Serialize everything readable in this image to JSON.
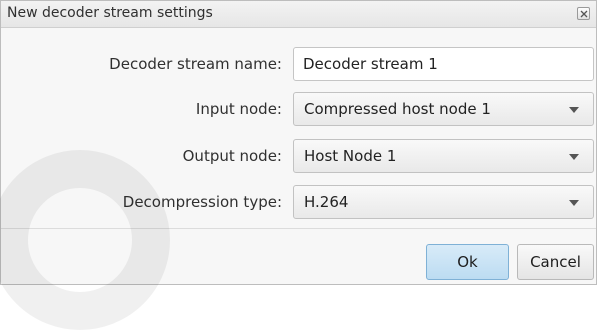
{
  "dialog": {
    "title": "New decoder stream settings",
    "close_icon": "close-icon"
  },
  "form": {
    "stream_name": {
      "label": "Decoder stream name:",
      "value": "Decoder stream 1"
    },
    "input_node": {
      "label": "Input node:",
      "value": "Compressed host node 1"
    },
    "output_node": {
      "label": "Output node:",
      "value": "Host Node 1"
    },
    "decompression_type": {
      "label": "Decompression type:",
      "value": "H.264"
    }
  },
  "buttons": {
    "ok": "Ok",
    "cancel": "Cancel"
  },
  "colors": {
    "ok_button": "#c9e3f6",
    "dialog_bg": "#f7f7f7",
    "border": "#bdbdbd"
  }
}
